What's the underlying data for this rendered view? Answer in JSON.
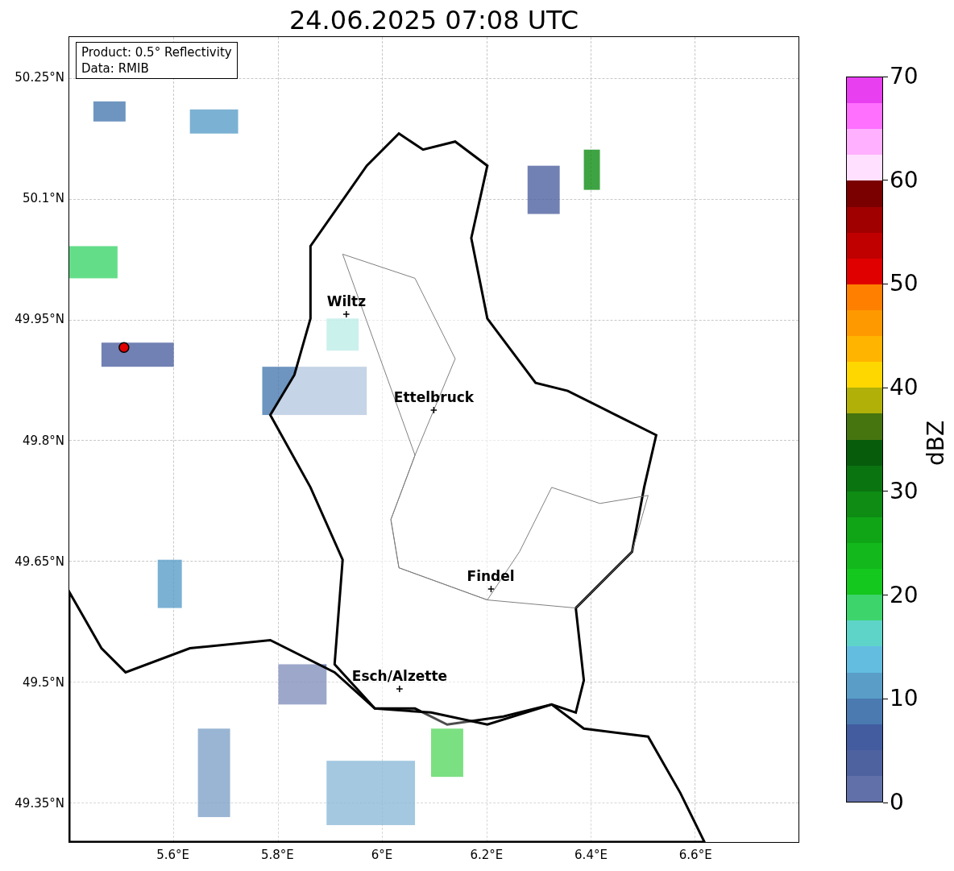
{
  "title": "24.06.2025 07:08 UTC",
  "info_box": [
    "Product: 0.5° Reflectivity",
    "Data: RMIB"
  ],
  "cities": [
    {
      "name": "Wiltz"
    },
    {
      "name": "Ettelbruck"
    },
    {
      "name": "Findel"
    },
    {
      "name": "Esch/Alzette"
    }
  ],
  "x_ticks": [
    "5.6°E",
    "5.8°E",
    "6°E",
    "6.2°E",
    "6.4°E",
    "6.6°E"
  ],
  "y_ticks": [
    "50.25°N",
    "50.1°N",
    "49.95°N",
    "49.8°N",
    "49.65°N",
    "49.5°N",
    "49.35°N"
  ],
  "colorbar": {
    "label": "dBZ",
    "ticks": [
      "70",
      "60",
      "50",
      "40",
      "30",
      "20",
      "10",
      "0"
    ],
    "bands": [
      {
        "color": "#e83ff0"
      },
      {
        "color": "#ff70ff"
      },
      {
        "color": "#ffb0ff"
      },
      {
        "color": "#ffe0ff"
      },
      {
        "color": "#7a0000"
      },
      {
        "color": "#a00000"
      },
      {
        "color": "#c00000"
      },
      {
        "color": "#e00000"
      },
      {
        "color": "#ff7f00"
      },
      {
        "color": "#ff9900"
      },
      {
        "color": "#ffb400"
      },
      {
        "color": "#ffd700"
      },
      {
        "color": "#b0b008"
      },
      {
        "color": "#467510"
      },
      {
        "color": "#075c0c"
      },
      {
        "color": "#0a7410"
      },
      {
        "color": "#0e8c14"
      },
      {
        "color": "#10a516"
      },
      {
        "color": "#12b81c"
      },
      {
        "color": "#14c81e"
      },
      {
        "color": "#3dd46c"
      },
      {
        "color": "#5ed4c8"
      },
      {
        "color": "#63bde0"
      },
      {
        "color": "#5a9ec8"
      },
      {
        "color": "#4a7ab0"
      },
      {
        "color": "#425c9f"
      },
      {
        "color": "#4f62a0"
      },
      {
        "color": "#6170a8"
      }
    ]
  }
}
